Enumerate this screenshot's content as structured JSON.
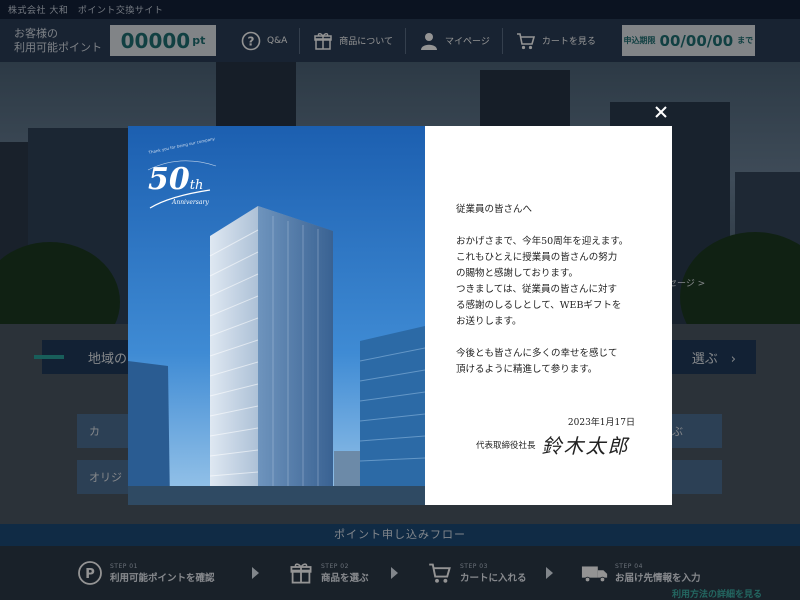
{
  "topbar": {
    "company": "株式会社 大和　ポイント交換サイト"
  },
  "header": {
    "points_label": "お客様の\n利用可能ポイント",
    "points_value": "00000",
    "points_unit": "pt",
    "nav": [
      {
        "label": "Q&A",
        "icon": "question-circle-icon"
      },
      {
        "label": "商品について",
        "icon": "gift-icon"
      },
      {
        "label": "マイページ",
        "icon": "person-icon"
      },
      {
        "label": "カートを見る",
        "icon": "cart-icon"
      }
    ],
    "deadline_label": "申込期限",
    "deadline_date": "00/00/00",
    "deadline_suffix": "まで"
  },
  "hero": {
    "link_fragment": "セージ >"
  },
  "categories": {
    "bar_left": "地域の",
    "bar_right": "選ぶ",
    "btn1": "カ",
    "btn2": "オリジ",
    "btn3": "ぶ"
  },
  "flow": {
    "title": "ポイント申し込みフロー",
    "steps": [
      {
        "num": "STEP 01",
        "label": "利用可能ポイントを確認",
        "icon": "points-icon"
      },
      {
        "num": "STEP 02",
        "label": "商品を選ぶ",
        "icon": "gift-icon"
      },
      {
        "num": "STEP 03",
        "label": "カートに入れる",
        "icon": "cart-icon"
      },
      {
        "num": "STEP 04",
        "label": "お届け先情報を入力",
        "icon": "truck-icon"
      }
    ],
    "more_link": "利用方法の詳細を見る"
  },
  "modal": {
    "logo_number": "50",
    "logo_suffix": "th",
    "logo_word": "Anniversary",
    "logo_arc": "Thank you for being our company",
    "greeting": "従業員の皆さんへ",
    "body1": "おかげさまで、今年50周年を迎えます。\nこれもひとえに授業員の皆さんの努力\nの賜物と感謝しております。\nつきましては、従業員の皆さんに対す\nる感謝のしるしとして、WEBギフトを\nお送りします。",
    "body2": "今後とも皆さんに多くの幸せを感じて\n頂けるように精進して参ります。",
    "date": "2023年1月17日",
    "signer_title": "代表取締役社長",
    "signer_name": "鈴木太郎"
  },
  "colors": {
    "accent": "#1e6f73",
    "header_bg": "#2a3d57",
    "flow_title_bg": "#1c4a78"
  }
}
